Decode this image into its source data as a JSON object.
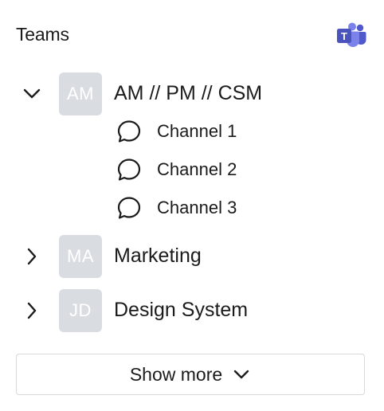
{
  "header": {
    "title": "Teams",
    "logo_icon": "microsoft-teams-logo",
    "logo_letter": "T"
  },
  "teams": [
    {
      "name": "AM // PM // CSM",
      "initials": "AM",
      "expanded": true,
      "channels": [
        {
          "label": "Channel 1",
          "icon": "chat-bubble-icon"
        },
        {
          "label": "Channel 2",
          "icon": "chat-bubble-icon"
        },
        {
          "label": "Channel 3",
          "icon": "chat-bubble-icon"
        }
      ]
    },
    {
      "name": "Marketing",
      "initials": "MA",
      "expanded": false,
      "channels": []
    },
    {
      "name": "Design System",
      "initials": "JD",
      "expanded": false,
      "channels": []
    }
  ],
  "show_more": {
    "label": "Show more",
    "icon": "chevron-down-icon"
  },
  "colors": {
    "avatar_bg": "#d9dde2",
    "teams_purple": "#5059c9",
    "teams_purple_light": "#7b83eb",
    "border": "#d8d8d8"
  }
}
